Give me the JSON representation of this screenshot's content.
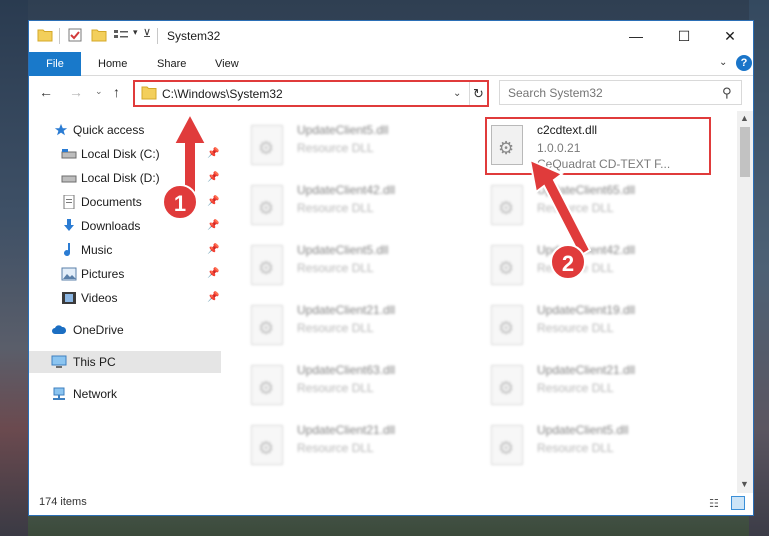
{
  "window": {
    "title": "System32",
    "controls": {
      "minimize": "—",
      "maximize": "☐",
      "close": "✕"
    }
  },
  "ribbon": {
    "tabs": [
      "File",
      "Home",
      "Share",
      "View"
    ],
    "help": "?"
  },
  "address_bar": {
    "path": "C:\\Windows\\System32",
    "refresh_icon": "refresh-icon"
  },
  "search": {
    "placeholder": "Search System32"
  },
  "sidebar": {
    "items": [
      {
        "label": "Quick access",
        "icon": "star-icon",
        "pinned": false
      },
      {
        "label": "Local Disk (C:)",
        "icon": "drive-icon",
        "pinned": true
      },
      {
        "label": "Local Disk (D:)",
        "icon": "drive-icon",
        "pinned": true
      },
      {
        "label": "Documents",
        "icon": "document-icon",
        "pinned": true
      },
      {
        "label": "Downloads",
        "icon": "download-icon",
        "pinned": true
      },
      {
        "label": "Music",
        "icon": "music-icon",
        "pinned": true
      },
      {
        "label": "Pictures",
        "icon": "picture-icon",
        "pinned": true
      },
      {
        "label": "Videos",
        "icon": "video-icon",
        "pinned": true
      },
      {
        "label": "OneDrive",
        "icon": "cloud-icon",
        "pinned": false
      },
      {
        "label": "This PC",
        "icon": "computer-icon",
        "pinned": false,
        "selected": true
      },
      {
        "label": "Network",
        "icon": "network-icon",
        "pinned": false
      }
    ]
  },
  "files": {
    "highlighted": {
      "name": "c2cdtext.dll",
      "version": "1.0.0.21",
      "description": "CeQuadrat CD-TEXT F..."
    },
    "left_column": [
      {
        "name": "UpdateClient5.dll",
        "description": "Resource DLL"
      },
      {
        "name": "UpdateClient42.dll",
        "description": "Resource DLL"
      },
      {
        "name": "UpdateClient5.dll",
        "description": "Resource DLL"
      },
      {
        "name": "UpdateClient21.dll",
        "description": "Resource DLL"
      },
      {
        "name": "UpdateClient63.dll",
        "description": "Resource DLL"
      },
      {
        "name": "UpdateClient21.dll",
        "description": "Resource DLL"
      }
    ],
    "right_column": [
      {
        "name": "UpdateClient65.dll",
        "description": "Resource DLL"
      },
      {
        "name": "UpdateClient42.dll",
        "description": "Resource DLL"
      },
      {
        "name": "UpdateClient19.dll",
        "description": "Resource DLL"
      },
      {
        "name": "UpdateClient21.dll",
        "description": "Resource DLL"
      },
      {
        "name": "UpdateClient5.dll",
        "description": "Resource DLL"
      }
    ]
  },
  "status": {
    "item_count": "174 items"
  },
  "annotations": {
    "step1": "1",
    "step2": "2"
  },
  "colors": {
    "accent": "#1979ca",
    "highlight": "#e03b3b",
    "selected_bg": "#e5e5e5"
  }
}
